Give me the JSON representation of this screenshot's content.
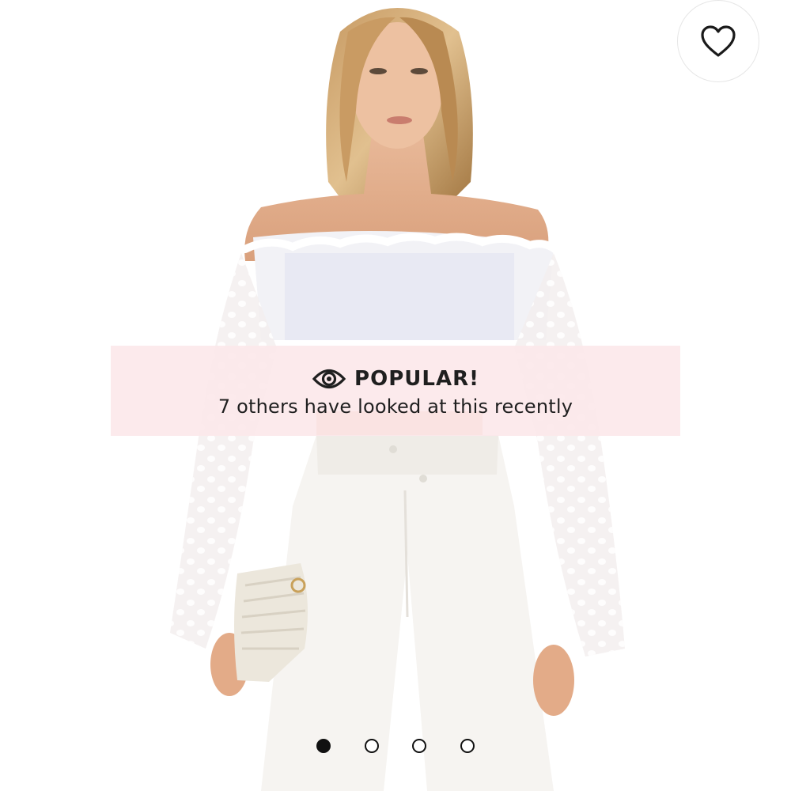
{
  "banner": {
    "icon": "eye-icon",
    "title": "POPULAR!",
    "subtitle": "7 others have looked at this recently",
    "background_color": "#fce8ea"
  },
  "favorite": {
    "icon": "heart-icon"
  },
  "carousel": {
    "total": 4,
    "active_index": 0
  }
}
